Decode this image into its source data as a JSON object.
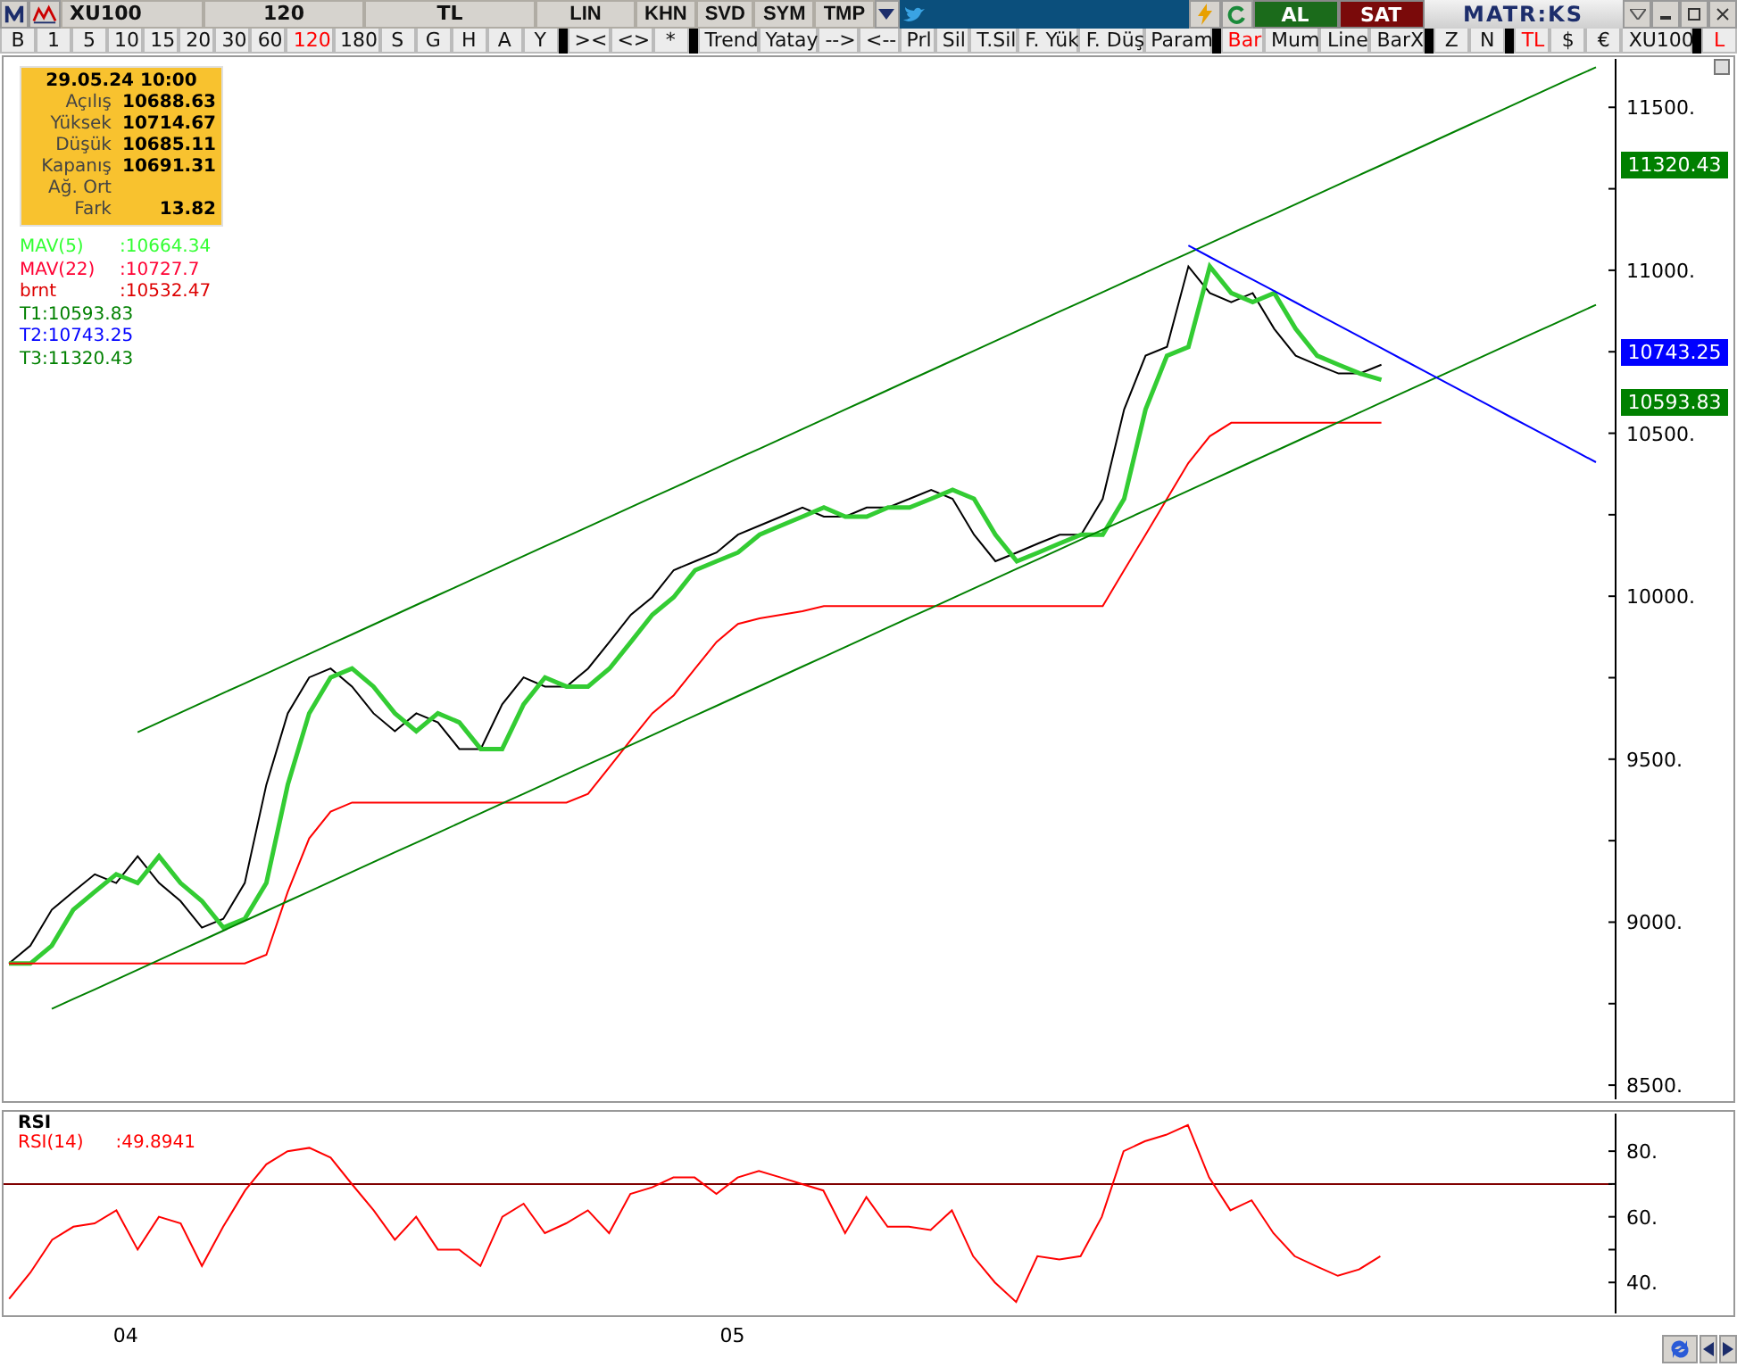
{
  "toolbar": {
    "symbol": "XU100",
    "period": "120",
    "currency": "TL",
    "buttons": [
      "LIN",
      "KHN",
      "SVD",
      "SYM",
      "TMP"
    ],
    "buy": "AL",
    "sell": "SAT",
    "logo": "MATR:KS"
  },
  "button_bar": [
    {
      "items": [
        {
          "label": "B",
          "selected": false
        },
        {
          "label": "1",
          "selected": false
        },
        {
          "label": "5",
          "selected": false
        },
        {
          "label": "10",
          "selected": false
        },
        {
          "label": "15",
          "selected": false
        },
        {
          "label": "20",
          "selected": false
        },
        {
          "label": "30",
          "selected": false
        },
        {
          "label": "60",
          "selected": false
        },
        {
          "label": "120",
          "selected": true
        },
        {
          "label": "180",
          "selected": false
        },
        {
          "label": "S",
          "selected": false
        },
        {
          "label": "G",
          "selected": false
        },
        {
          "label": "H",
          "selected": false
        },
        {
          "label": "A",
          "selected": false
        },
        {
          "label": "Y",
          "selected": false
        }
      ]
    },
    {
      "items": [
        {
          "label": "><"
        },
        {
          "label": "<>"
        },
        {
          "label": "*"
        }
      ]
    },
    {
      "items": [
        {
          "label": "Trend"
        },
        {
          "label": "Yatay"
        },
        {
          "label": "-->"
        },
        {
          "label": "<--"
        },
        {
          "label": "Prl"
        },
        {
          "label": "Sil"
        },
        {
          "label": "T.Sil"
        },
        {
          "label": "F. Yük"
        },
        {
          "label": "F. Düş"
        },
        {
          "label": "Param"
        }
      ]
    },
    {
      "items": [
        {
          "label": "Bar",
          "selected": true
        },
        {
          "label": "Mum",
          "selected": false
        },
        {
          "label": "Line",
          "selected": false
        },
        {
          "label": "BarX",
          "selected": false
        }
      ]
    },
    {
      "items": [
        {
          "label": "Z"
        },
        {
          "label": "N"
        }
      ]
    },
    {
      "items": [
        {
          "label": "TL",
          "selected": true
        },
        {
          "label": "$",
          "selected": false
        },
        {
          "label": "€",
          "selected": false
        },
        {
          "label": "XU100",
          "selected": false
        }
      ]
    },
    {
      "items": [
        {
          "label": "L",
          "selected": true
        }
      ]
    }
  ],
  "info_box": {
    "date": "29.05.24 10:00",
    "rows": [
      {
        "label": "Açılış",
        "value": "10688.63"
      },
      {
        "label": "Yüksek",
        "value": "10714.67"
      },
      {
        "label": "Düşük",
        "value": "10685.11"
      },
      {
        "label": "Kapanış",
        "value": "10691.31"
      },
      {
        "label": "Ağ. Ort"
      },
      {
        "label": "Fark",
        "value": "13.82"
      }
    ]
  },
  "legend": [
    {
      "name": "MAV(5)",
      "value": ":10664.34",
      "color": "#33ff33"
    },
    {
      "name": "MAV(22)",
      "value": ":10727.7",
      "color": "#ff0033"
    },
    {
      "name": "brnt",
      "value": ":10532.47",
      "color": "#dd0000"
    },
    {
      "name": "T1:10593.83",
      "color": "#008000"
    },
    {
      "name": "T2:10743.25",
      "color": "#0000ff"
    },
    {
      "name": "T3:11320.43",
      "color": "#008000"
    }
  ],
  "price_chart": {
    "price_tags": [
      {
        "text": "11320.43",
        "color": "#008000"
      },
      {
        "text": "10743.25",
        "color": "#0000ff"
      },
      {
        "text": "10593.83",
        "color": "#008000"
      }
    ],
    "chart_data": {
      "type": "line",
      "categories": [
        null,
        null,
        null,
        null,
        null,
        null,
        null,
        null,
        null,
        null,
        null,
        null,
        null,
        null,
        null,
        null,
        null,
        null,
        null,
        null,
        null,
        null,
        null,
        null,
        null,
        null,
        null,
        null,
        null,
        null,
        null,
        null,
        null,
        null,
        null,
        null,
        null,
        null,
        null,
        null,
        null,
        null,
        null,
        null,
        null,
        null,
        null,
        null,
        null,
        null,
        null,
        null,
        null,
        null,
        null,
        null,
        null,
        null,
        null,
        null,
        null,
        null,
        null,
        null,
        null,
        null,
        null,
        null,
        null,
        null,
        null,
        null,
        null,
        null,
        null
      ],
      "ylim": [
        8451,
        11654
      ],
      "yticks": [
        {
          "value": 8500,
          "label": "8500."
        },
        {
          "value": 9000,
          "label": "9000."
        },
        {
          "value": 9500,
          "label": "9500."
        },
        {
          "value": 10000,
          "label": "10000."
        },
        {
          "value": 10500,
          "label": "10500."
        },
        {
          "value": 11000,
          "label": "11000."
        },
        {
          "value": 11500,
          "label": "11500."
        }
      ],
      "series": [
        {
          "color": "#000000",
          "values": [
            8873,
            8928,
            9038,
            9093,
            9147,
            9120,
            9202,
            9120,
            9065,
            8983,
            9010,
            9120,
            9422,
            9641,
            9751,
            9778,
            9723,
            9641,
            9586,
            9641,
            9613,
            9531,
            9531,
            9668,
            9751,
            9723,
            9723,
            9778,
            9860,
            9943,
            9997,
            10080,
            10107,
            10134,
            10189,
            10217,
            10244,
            10272,
            10244,
            10244,
            10272,
            10272,
            10299,
            10326,
            10299,
            10189,
            10107,
            10134,
            10162,
            10189,
            10189,
            10299,
            10573,
            10738,
            10765,
            11012,
            10930,
            10902,
            10930,
            10820,
            10738,
            10710,
            10683,
            10683,
            10710,
            null,
            null,
            null,
            null,
            null,
            null,
            null,
            null,
            null,
            null
          ]
        },
        {
          "color": "#33cc33",
          "values": [
            8873,
            8873,
            8928,
            9038,
            9093,
            9147,
            9120,
            9202,
            9120,
            9065,
            8983,
            9010,
            9120,
            9422,
            9641,
            9751,
            9778,
            9723,
            9641,
            9586,
            9641,
            9613,
            9531,
            9531,
            9668,
            9751,
            9723,
            9723,
            9778,
            9860,
            9943,
            9997,
            10080,
            10107,
            10134,
            10189,
            10217,
            10244,
            10272,
            10244,
            10244,
            10272,
            10272,
            10299,
            10326,
            10299,
            10189,
            10107,
            10134,
            10162,
            10189,
            10189,
            10299,
            10573,
            10738,
            10765,
            11012,
            10930,
            10902,
            10930,
            10820,
            10738,
            10710,
            10683,
            10664,
            null,
            null,
            null,
            null,
            null,
            null,
            null,
            null,
            null,
            null
          ]
        },
        {
          "color": "#ff0000",
          "values": [
            8873,
            8873,
            8873,
            8873,
            8873,
            8873,
            8873,
            8873,
            8873,
            8873,
            8873,
            8873,
            8900,
            9093,
            9257,
            9339,
            9367,
            9367,
            9367,
            9367,
            9367,
            9367,
            9367,
            9367,
            9367,
            9367,
            9367,
            9394,
            9476,
            9559,
            9641,
            9696,
            9778,
            9860,
            9915,
            9932,
            9943,
            9954,
            9970,
            9970,
            9970,
            9970,
            9970,
            9970,
            9970,
            9970,
            9970,
            9970,
            9970,
            9970,
            9970,
            9970,
            10080,
            10189,
            10299,
            10409,
            10491,
            10532,
            10532,
            10532,
            10532,
            10532,
            10532,
            10532,
            10532,
            null,
            null,
            null,
            null,
            null,
            null,
            null,
            null,
            null,
            null
          ]
        },
        {
          "color": "#008000",
          "values": [
            null,
            null,
            null,
            null,
            null,
            null,
            9583,
            9613,
            9643,
            9673,
            9703,
            9733,
            9763,
            9793,
            9823,
            9853,
            9883,
            9913,
            9943,
            9973,
            10003,
            10033,
            10063,
            10093,
            10123,
            10153,
            10183,
            10213,
            10243,
            10273,
            10303,
            10333,
            10363,
            10393,
            10423,
            10453,
            10483,
            10513,
            10543,
            10573,
            10603,
            10633,
            10663,
            10693,
            10723,
            10753,
            10783,
            10813,
            10843,
            10873,
            10903,
            10933,
            10963,
            10993,
            11023,
            11053,
            11083,
            11113,
            11143,
            11173,
            11203,
            11233,
            11263,
            11293,
            11323,
            11353,
            11383,
            11413,
            11443,
            11473,
            11503,
            11533,
            11563,
            11593,
            11623
          ]
        },
        {
          "color": "#008000",
          "values": [
            null,
            null,
            8734,
            8764,
            8794,
            8824,
            8854,
            8884,
            8914,
            8944,
            8974,
            9004,
            9034,
            9064,
            9094,
            9124,
            9154,
            9184,
            9214,
            9244,
            9274,
            9304,
            9334,
            9364,
            9394,
            9424,
            9454,
            9484,
            9514,
            9544,
            9574,
            9604,
            9634,
            9664,
            9694,
            9724,
            9754,
            9784,
            9814,
            9844,
            9874,
            9904,
            9934,
            9964,
            9994,
            10024,
            10054,
            10084,
            10114,
            10144,
            10174,
            10204,
            10234,
            10264,
            10294,
            10324,
            10354,
            10384,
            10414,
            10444,
            10474,
            10504,
            10534,
            10564,
            10594,
            10624,
            10654,
            10684,
            10714,
            10744,
            10774,
            10804,
            10834,
            10864,
            10894
          ]
        },
        {
          "color": "#0000ff",
          "values": [
            null,
            null,
            null,
            null,
            null,
            null,
            null,
            null,
            null,
            null,
            null,
            null,
            null,
            null,
            null,
            null,
            null,
            null,
            null,
            null,
            null,
            null,
            null,
            null,
            null,
            null,
            null,
            null,
            null,
            null,
            null,
            null,
            null,
            null,
            null,
            null,
            null,
            null,
            null,
            null,
            null,
            null,
            null,
            null,
            null,
            null,
            null,
            null,
            null,
            null,
            null,
            null,
            null,
            null,
            null,
            11076,
            11041,
            11006,
            10971,
            10936,
            10901,
            10866,
            10831,
            10796,
            10761,
            10726,
            10691,
            10656,
            10621,
            10586,
            10551,
            10516,
            10481,
            10446,
            10411
          ]
        }
      ]
    }
  },
  "rsi_panel": {
    "title": "RSI",
    "legend": {
      "name": "RSI(14)",
      "value": ":49.8941"
    },
    "chart_data": {
      "type": "line",
      "x": [
        3.802,
        3.837,
        3.873,
        3.908,
        3.943,
        3.979,
        4.014,
        4.049,
        4.085,
        4.12,
        4.155,
        4.191,
        4.226,
        4.261,
        4.297,
        4.332,
        4.367,
        4.403,
        4.438,
        4.473,
        4.509,
        4.544,
        4.579,
        4.615,
        4.65,
        4.685,
        4.72,
        4.756,
        4.791,
        4.826,
        4.862,
        4.897,
        4.932,
        4.968,
        5.003,
        5.038,
        5.074,
        5.109,
        5.144,
        5.18,
        5.215,
        5.25,
        5.285,
        5.321,
        5.356,
        5.391,
        5.427,
        5.462,
        5.497,
        5.533,
        5.568,
        5.603,
        5.639,
        5.674,
        5.709,
        5.745,
        5.78,
        5.815,
        5.85,
        5.886,
        5.921,
        5.956,
        5.992,
        6.027,
        6.062
      ],
      "xlim": [
        3.793,
        6.65
      ],
      "ylim": [
        30,
        92
      ],
      "xticks": [
        {
          "value": 4,
          "label": "04"
        },
        {
          "value": 5,
          "label": "05"
        }
      ],
      "yticks": [
        {
          "value": 40,
          "label": "40."
        },
        {
          "value": 60,
          "label": "60."
        },
        {
          "value": 80,
          "label": "80."
        }
      ],
      "series": [
        {
          "color": "#ff0000",
          "values": [
            35,
            43,
            53,
            57,
            58,
            62,
            50,
            60,
            58,
            45,
            57,
            68,
            76,
            80,
            81,
            78,
            70,
            62,
            53,
            60,
            50,
            50,
            45,
            60,
            64,
            55,
            58,
            62,
            55,
            67,
            69,
            72,
            72,
            67,
            72,
            74,
            72,
            70,
            68,
            55,
            66,
            57,
            57,
            56,
            62,
            48,
            40,
            34,
            48,
            47,
            48,
            60,
            80,
            83,
            85,
            88,
            72,
            62,
            65,
            55,
            48,
            45,
            42,
            44,
            48
          ]
        }
      ],
      "ref_lines": [
        {
          "axis": "y",
          "value": 70
        }
      ]
    }
  }
}
